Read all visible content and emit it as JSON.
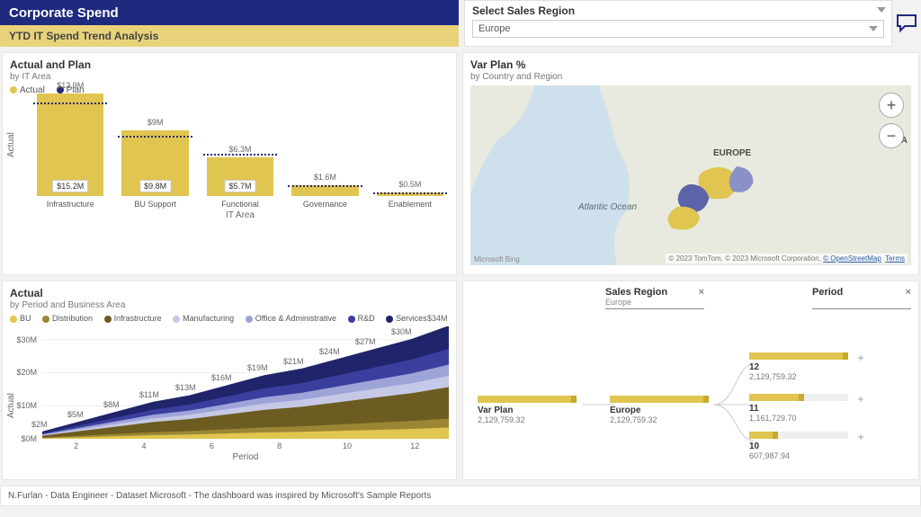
{
  "header": {
    "title": "Corporate Spend",
    "subtitle": "YTD IT Spend Trend Analysis"
  },
  "slicer": {
    "label": "Select Sales Region",
    "value": "Europe"
  },
  "colors": {
    "actual": "#e0c550",
    "plan": "#2b2b6e",
    "bu": "#e0c550",
    "distribution": "#9b8633",
    "infrastructure": "#6d5c21",
    "manufacturing": "#c6c9e6",
    "office": "#9ea4d8",
    "rd": "#3a3f9e",
    "services": "#20246b"
  },
  "actual_plan": {
    "title": "Actual and Plan",
    "sub": "by IT Area",
    "ylabel": "Actual",
    "xlabel": "IT Area",
    "legend_actual": "Actual",
    "legend_plan": "Plan"
  },
  "map_card": {
    "title": "Var Plan %",
    "sub": "by Country and Region",
    "europe_label": "EUROPE",
    "asia_label": "ASIA",
    "ocean_label": "Atlantic Ocean",
    "bing": "Microsoft Bing",
    "attrib_prefix": "© 2023 TomTom, © 2023 Microsoft Corporation, ",
    "attrib_osm": "© OpenStreetMap",
    "attrib_terms": "Terms"
  },
  "area_card": {
    "title": "Actual",
    "sub": "by Period and Business Area",
    "xlabel": "Period",
    "ylabel": "Actual",
    "legend": {
      "bu": "BU",
      "distribution": "Distribution",
      "infrastructure": "Infrastructure",
      "manufacturing": "Manufacturing",
      "office": "Office & Administrative",
      "rd": "R&D",
      "services": "Services"
    }
  },
  "decomp": {
    "col_region": "Sales Region",
    "col_period": "Period",
    "region_sub": "Europe",
    "root_label": "Var Plan",
    "root_value": "2,129,759.32",
    "europe_label": "Europe",
    "europe_value": "2,129,759.32",
    "p12_label": "12",
    "p12_value": "2,129,759.32",
    "p11_label": "11",
    "p11_value": "1,161,729.70",
    "p10_label": "10",
    "p10_value": "607,987.94"
  },
  "footer": "N.Furlan - Data Engineer - Dataset Microsoft - The dashboard was inspired by Microsoft's Sample Reports",
  "chart_data": [
    {
      "type": "bar",
      "name": "Actual and Plan by IT Area",
      "categories": [
        "Infrastructure",
        "BU Support",
        "Functional",
        "Governance",
        "Enablement"
      ],
      "series": [
        {
          "name": "Actual",
          "values": [
            15.2,
            9.8,
            5.7,
            1.6,
            0.5
          ],
          "unit": "M"
        },
        {
          "name": "Plan",
          "values": [
            13.9,
            9.0,
            6.3,
            1.6,
            0.5
          ],
          "unit": "M"
        }
      ],
      "ylabel": "Actual",
      "xlabel": "IT Area",
      "ylim": [
        0,
        16
      ]
    },
    {
      "type": "area",
      "name": "Actual by Period and Business Area (stacked cumulative)",
      "x": [
        1,
        2,
        3,
        4,
        5,
        6,
        7,
        8,
        9,
        10,
        11,
        12
      ],
      "totals_M": [
        2,
        5,
        8,
        11,
        13,
        16,
        19,
        21,
        24,
        27,
        30,
        34
      ],
      "series_names": [
        "BU",
        "Distribution",
        "Infrastructure",
        "Manufacturing",
        "Office & Administrative",
        "R&D",
        "Services"
      ],
      "ylabel": "Actual",
      "xlabel": "Period",
      "ylim": [
        0,
        34
      ],
      "yticks": [
        "$0M",
        "$10M",
        "$20M",
        "$30M"
      ]
    },
    {
      "type": "map",
      "name": "Var Plan % by Country and Region",
      "region": "Europe",
      "note": "Choropleth over Western Europe; exact country values not labeled"
    },
    {
      "type": "table",
      "name": "Decomposition tree — Var Plan",
      "rows": [
        {
          "level": 0,
          "label": "Var Plan",
          "value": 2129759.32
        },
        {
          "level": 1,
          "label": "Europe",
          "value": 2129759.32
        },
        {
          "level": 2,
          "label": "12",
          "value": 2129759.32
        },
        {
          "level": 2,
          "label": "11",
          "value": 1161729.7
        },
        {
          "level": 2,
          "label": "10",
          "value": 607987.94
        }
      ]
    }
  ]
}
